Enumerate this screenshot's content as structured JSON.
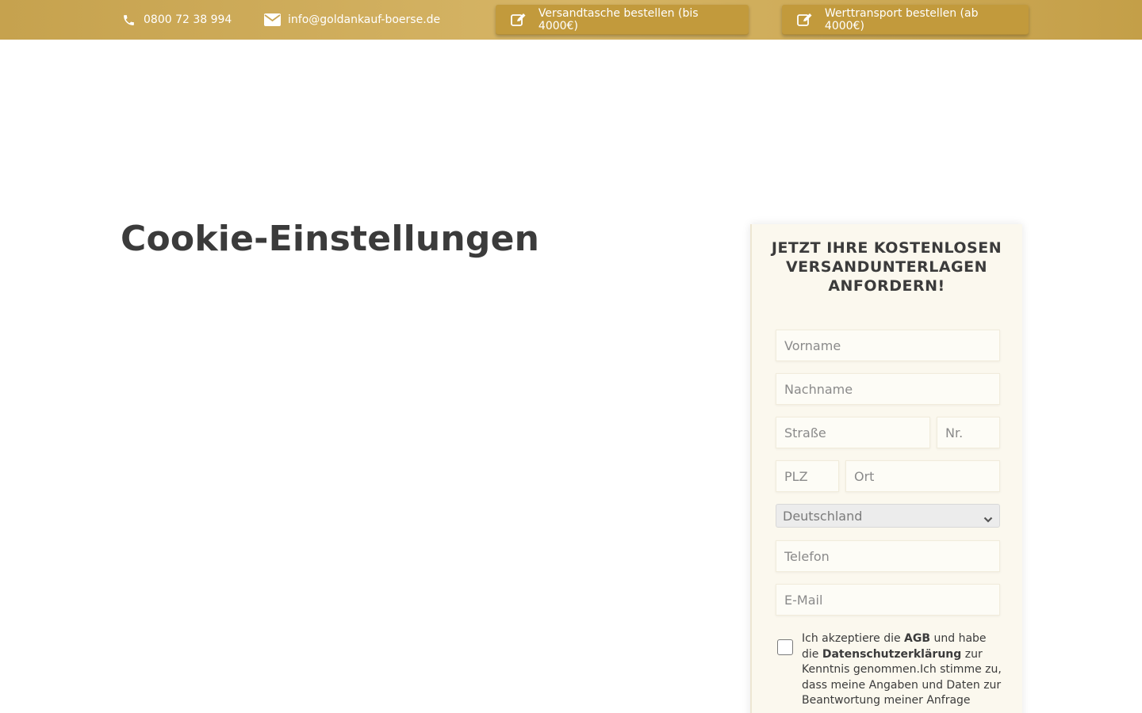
{
  "topbar": {
    "phone": "0800 72 38 994",
    "email": "info@goldankauf-boerse.de",
    "order_bag_label": "Versandtasche bestellen (bis 4000€)",
    "order_transport_label": "Werttransport bestellen (ab 4000€)",
    "icons": {
      "phone": "phone-icon",
      "mail": "envelope-icon",
      "edit": "edit-icon"
    },
    "colors": {
      "bar": "#c9a552",
      "button": "#c29a3c"
    }
  },
  "page": {
    "title": "Cookie-Einstellungen"
  },
  "form": {
    "title": "JETZT IHRE KOSTENLOSEN VERSANDUNTERLAGEN ANFORDERN!",
    "fields": {
      "firstname_placeholder": "Vorname",
      "lastname_placeholder": "Nachname",
      "street_placeholder": "Straße",
      "number_placeholder": "Nr.",
      "zip_placeholder": "PLZ",
      "city_placeholder": "Ort",
      "country_selected": "Deutschland",
      "phone_placeholder": "Telefon",
      "email_placeholder": "E-Mail"
    },
    "consent": {
      "part1": "Ich akzeptiere die ",
      "agb": "AGB",
      "part2": " und habe die ",
      "privacy": "Datenschutzerklärung",
      "part3": " zur Kenntnis genommen.Ich stimme zu, dass meine Angaben und Daten zur Beantwortung meiner Anfrage",
      "checked": false
    }
  }
}
